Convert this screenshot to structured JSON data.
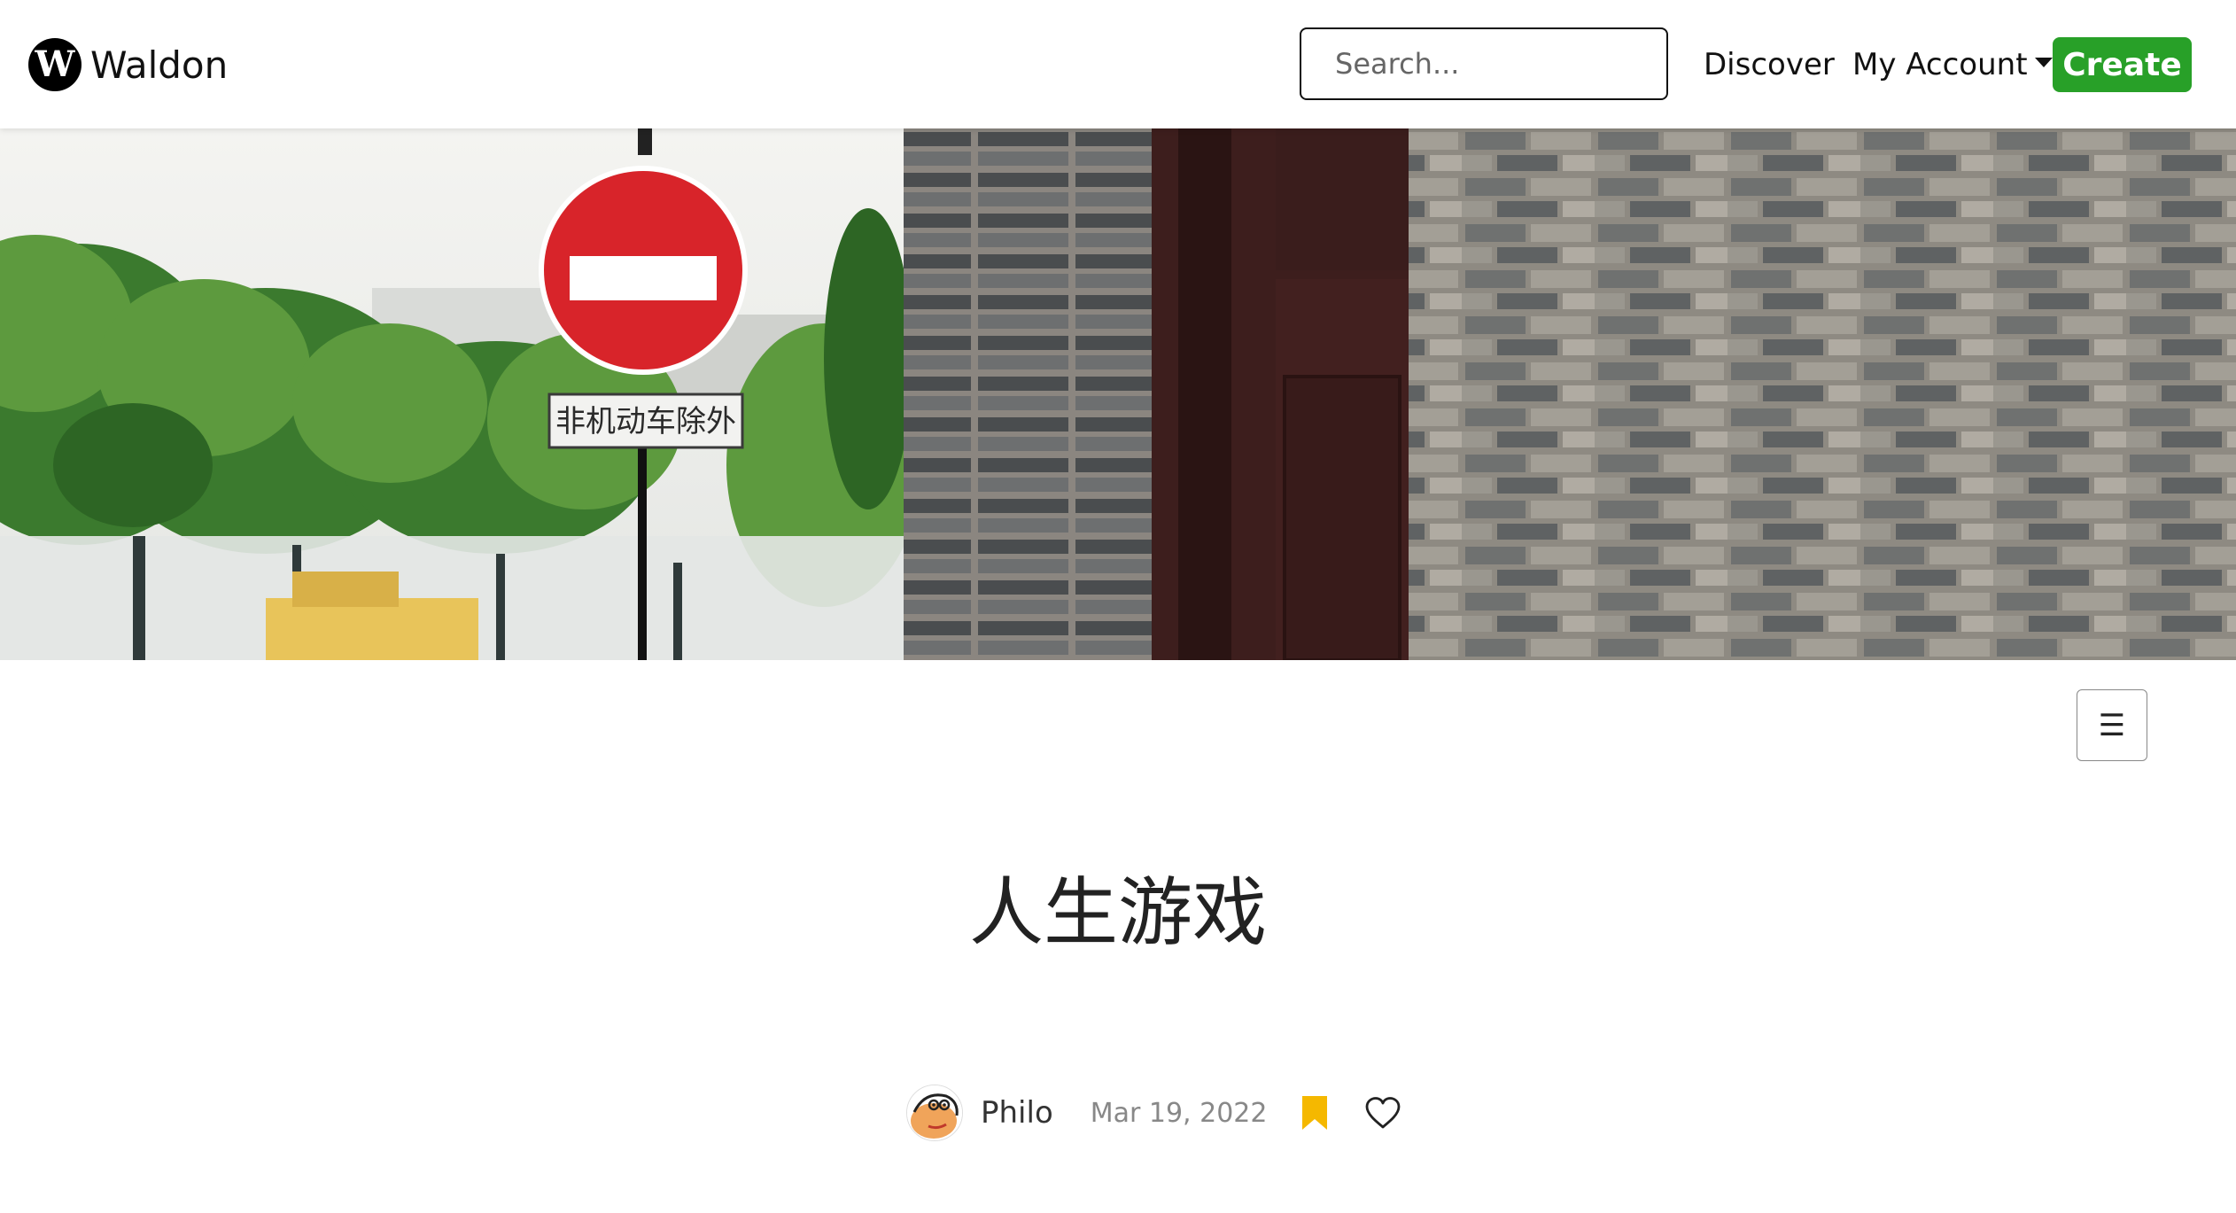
{
  "navbar": {
    "brand_initial": "W",
    "brand_name": "Waldon",
    "search_placeholder": "Search...",
    "discover_label": "Discover",
    "account_label": "My Account",
    "create_label": "Create"
  },
  "hero": {
    "sign_text": "非机动车除外"
  },
  "toc": {
    "icon": "hamburger-icon",
    "glyph": "☰"
  },
  "article": {
    "title": "人生游戏",
    "author": "Philo",
    "date": "Mar 19, 2022"
  },
  "colors": {
    "create_button": "#28a028",
    "bookmark": "#f5b800",
    "no_entry_sign": "#d8242a"
  },
  "icons": {
    "brand": "waldon-logo-icon",
    "account_caret": "caret-down-icon",
    "bookmark": "bookmark-icon",
    "like": "heart-icon"
  }
}
